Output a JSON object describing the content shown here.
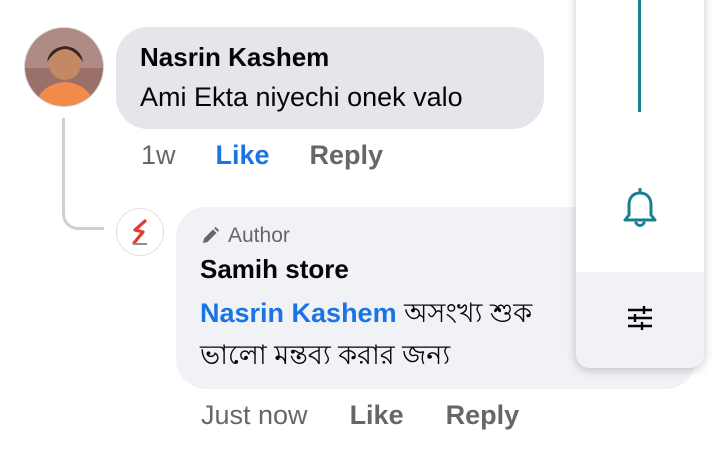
{
  "comment": {
    "author": "Nasrin Kashem",
    "text": "Ami Ekta niyechi onek valo",
    "time": "1w",
    "like_label": "Like",
    "reply_label": "Reply"
  },
  "reply": {
    "badge": "Author",
    "author": "Samih store",
    "mention": "Nasrin Kashem",
    "text": " অসংখ্য শুক ভালো মন্তব্য করার জন্য",
    "time": "Just now",
    "like_label": "Like",
    "reply_label": "Reply"
  },
  "panel": {
    "icons": [
      "bell-icon",
      "sliders-icon"
    ],
    "accent": "#1a7f8e"
  },
  "colors": {
    "link": "#1b74e4",
    "muted": "#65676b",
    "bubble": "#e4e6eb"
  }
}
